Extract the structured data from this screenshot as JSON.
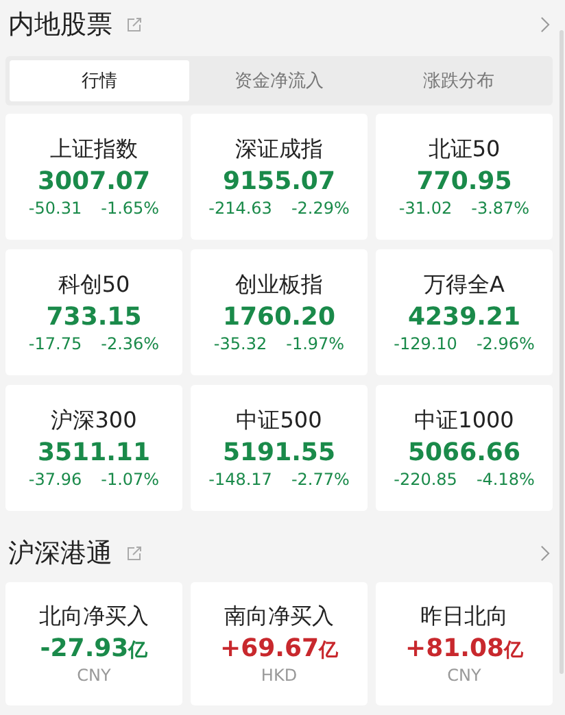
{
  "market": {
    "title": "内地股票",
    "tabs": [
      {
        "label": "行情",
        "selected": true
      },
      {
        "label": "资金净流入",
        "selected": false
      },
      {
        "label": "涨跌分布",
        "selected": false
      }
    ],
    "indices": [
      {
        "name": "上证指数",
        "value": "3007.07",
        "change": "-50.31",
        "pct": "-1.65%",
        "color": "#1a8a4a"
      },
      {
        "name": "深证成指",
        "value": "9155.07",
        "change": "-214.63",
        "pct": "-2.29%",
        "color": "#1a8a4a"
      },
      {
        "name": "北证50",
        "value": "770.95",
        "change": "-31.02",
        "pct": "-3.87%",
        "color": "#1a8a4a"
      },
      {
        "name": "科创50",
        "value": "733.15",
        "change": "-17.75",
        "pct": "-2.36%",
        "color": "#1a8a4a"
      },
      {
        "name": "创业板指",
        "value": "1760.20",
        "change": "-35.32",
        "pct": "-1.97%",
        "color": "#1a8a4a"
      },
      {
        "name": "万得全A",
        "value": "4239.21",
        "change": "-129.10",
        "pct": "-2.96%",
        "color": "#1a8a4a"
      },
      {
        "name": "沪深300",
        "value": "3511.11",
        "change": "-37.96",
        "pct": "-1.07%",
        "color": "#1a8a4a"
      },
      {
        "name": "中证500",
        "value": "5191.55",
        "change": "-148.17",
        "pct": "-2.77%",
        "color": "#1a8a4a"
      },
      {
        "name": "中证1000",
        "value": "5066.66",
        "change": "-220.85",
        "pct": "-4.18%",
        "color": "#1a8a4a"
      }
    ]
  },
  "connect": {
    "title": "沪深港通",
    "flows": [
      {
        "name": "北向净买入",
        "value": "-27.93",
        "unit": "亿",
        "currency": "CNY",
        "color": "#1a8a4a"
      },
      {
        "name": "南向净买入",
        "value": "+69.67",
        "unit": "亿",
        "currency": "HKD",
        "color": "#c8282d"
      },
      {
        "name": "昨日北向",
        "value": "+81.08",
        "unit": "亿",
        "currency": "CNY",
        "color": "#c8282d"
      }
    ]
  }
}
